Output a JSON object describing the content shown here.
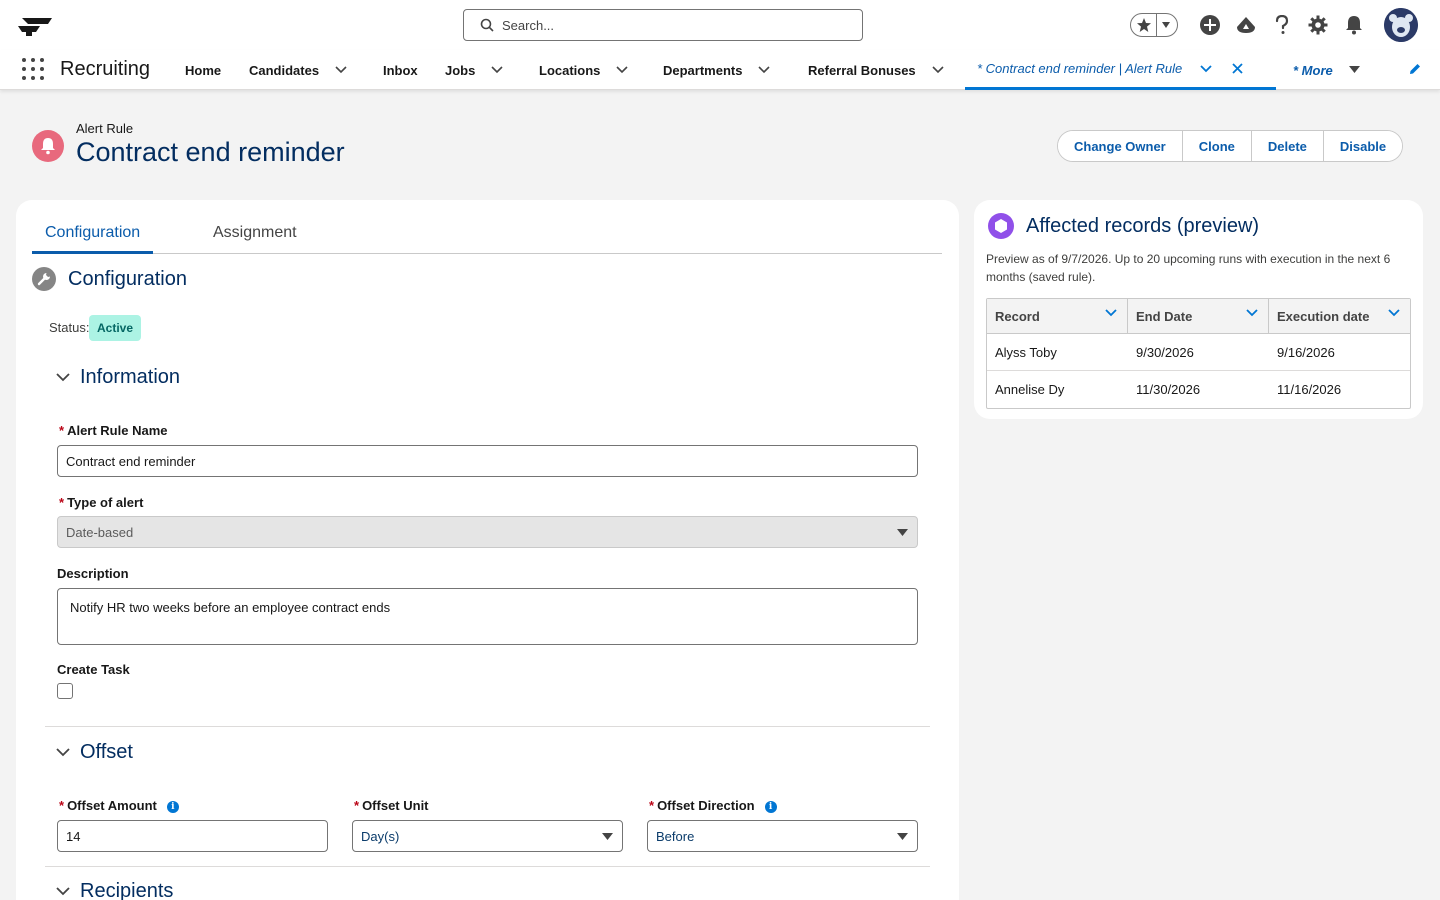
{
  "header": {
    "search_placeholder": "Search..."
  },
  "nav": {
    "app_name": "Recruiting",
    "items": [
      {
        "label": "Home"
      },
      {
        "label": "Candidates"
      },
      {
        "label": "Inbox"
      },
      {
        "label": "Jobs"
      },
      {
        "label": "Locations"
      },
      {
        "label": "Departments"
      },
      {
        "label": "Referral Bonuses"
      }
    ],
    "active_tab": "* Contract end reminder | Alert Rule",
    "more_label": "* More"
  },
  "record": {
    "type": "Alert Rule",
    "title": "Contract end reminder",
    "actions": [
      "Change Owner",
      "Clone",
      "Delete",
      "Disable"
    ]
  },
  "tabs": {
    "configuration": "Configuration",
    "assignment": "Assignment"
  },
  "config": {
    "section_title": "Configuration",
    "status_label": "Status:",
    "status_value": "Active",
    "information": {
      "title": "Information",
      "alert_rule_name_label": "Alert Rule Name",
      "alert_rule_name_value": "Contract end reminder",
      "type_label": "Type of alert",
      "type_value": "Date-based",
      "description_label": "Description",
      "description_value": "Notify HR two weeks before an employee contract ends",
      "create_task_label": "Create Task"
    },
    "offset": {
      "title": "Offset",
      "amount_label": "Offset Amount",
      "amount_value": "14",
      "unit_label": "Offset Unit",
      "unit_value": "Day(s)",
      "direction_label": "Offset Direction",
      "direction_value": "Before"
    },
    "recipients": {
      "title": "Recipients"
    }
  },
  "preview": {
    "title": "Affected records (preview)",
    "description": "Preview as of 9/7/2026. Up to 20 upcoming runs with execution in the next 6 months (saved rule).",
    "columns": [
      "Record",
      "End Date",
      "Execution date"
    ],
    "rows": [
      [
        "Alyss Toby",
        "9/30/2026",
        "9/16/2026"
      ],
      [
        "Annelise Dy",
        "11/30/2026",
        "11/16/2026"
      ]
    ]
  },
  "colors": {
    "brand_blue": "#0b5cab",
    "title_navy": "#032d60",
    "alert_icon": "#e8697d",
    "active_badge_bg": "#acf3e4",
    "preview_icon": "#9050e9"
  }
}
